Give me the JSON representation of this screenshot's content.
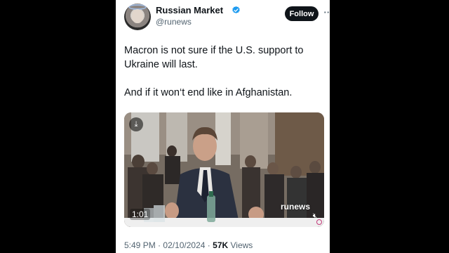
{
  "author": {
    "display_name": "Russian Market",
    "handle": "@runews",
    "verified": true,
    "verified_color": "#1d9bf0"
  },
  "header": {
    "follow_label": "Follow",
    "more_icon": "more-horizontal-icon"
  },
  "tweet": {
    "paragraphs": [
      "Macron is not sure if the U.S. support to Ukraine will last.",
      "And if it won‘t end like in Afghanistan."
    ]
  },
  "video": {
    "duration": "1:01",
    "watermark": "runews",
    "download_icon": "download-icon",
    "mute_icon": "speaker-muted-icon"
  },
  "meta": {
    "time": "5:49 PM",
    "separator": "·",
    "date": "02/10/2024",
    "views_count": "57K",
    "views_label": "Views"
  }
}
